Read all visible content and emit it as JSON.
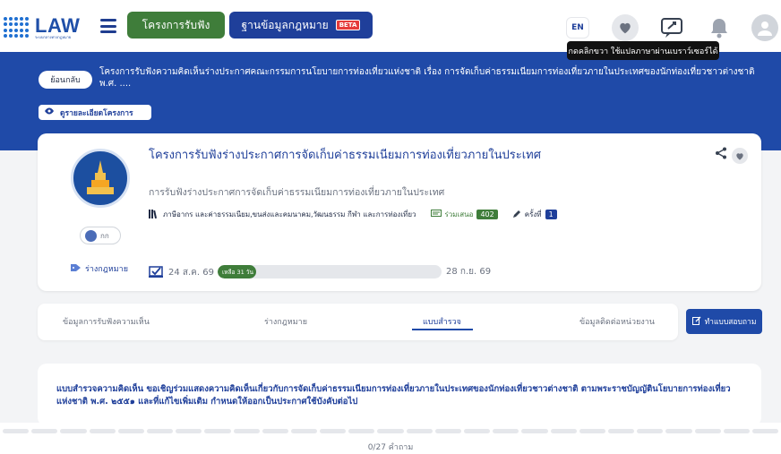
{
  "header": {
    "logo_word": "LAW",
    "logo_sub": "ระบบกลางทางกฎหมาย",
    "projects_label": "โครงการรับฟัง",
    "lawdb_label": "ฐานข้อมูลกฎหมาย",
    "beta_label": "BETA",
    "lang_label": "EN",
    "tooltip": "กดคลิกขวา ใช้แปลภาษาผ่านเบราว์เซอร์ได้"
  },
  "banner": {
    "back_label": "ย้อนกลับ",
    "title": "โครงการรับฟังความคิดเห็นร่างประกาศคณะกรรมการนโยบายการท่องเที่ยวแห่งชาติ เรื่อง การจัดเก็บค่าธรรมเนียมการท่องเที่ยวภายในประเทศของนักท่องเที่ยวชาวต่างชาติ พ.ศ. ....",
    "detail_label": "ดูรายละเอียดโครงการ"
  },
  "project": {
    "title": "โครงการรับฟังร่างประกาศการจัดเก็บค่าธรรมเนียมการท่องเที่ยวภายในประเทศ",
    "description": "การรับฟังร่างประกาศการจัดเก็บค่าธรรมเนียมการท่องเที่ยวภายในประเทศ",
    "categories": "ภาษีอากร และค่าธรรมเนียม,ขนส่งและคมนาคม,วัฒนธรรม กีฬา และการท่องเที่ยว",
    "participants_label": "ร่วมเสนอ",
    "participants_count": "402",
    "round_label": "ครั้งที่",
    "round_value": "1",
    "user_label": "กก",
    "law_tag": "ร่างกฎหมาย",
    "start_date": "24 ส.ค. 69",
    "end_date": "28 ก.ย. 69",
    "remaining_label": "เหลือ 31 วัน",
    "progress_fraction": 0.17
  },
  "tabs": [
    {
      "label": "ข้อมูลการรับฟังความเห็น",
      "active": false
    },
    {
      "label": "ร่างกฎหมาย",
      "active": false
    },
    {
      "label": "แบบสำรวจ",
      "active": true
    },
    {
      "label": "ข้อมูลติดต่อหน่วยงาน",
      "active": false
    }
  ],
  "survey_button_label": "ทำแบบสอบถาม",
  "survey": {
    "intro": "แบบสำรวจความคิดเห็น ขอเชิญร่วมแสดงความคิดเห็นเกี่ยวกับการจัดเก็บค่าธรรมเนียมการท่องเที่ยวภายในประเทศของนักท่องเที่ยวชาวต่างชาติ ตามพระราชบัญญัตินโยบายการท่องเที่ยวแห่งชาติ พ.ศ. ๒๕๕๑ และที่แก้ไขเพิ่มเติม กำหนดให้ออกเป็นประกาศใช้บังคับต่อไป"
  },
  "question_counter": "0/27 คำถาม",
  "colors": {
    "brand_blue": "#1f4aa8",
    "brand_green": "#3f7d3a",
    "beta_red": "#e53b3b"
  },
  "icons": [
    "logo-dots-icon",
    "hamburger-icon",
    "heart-icon",
    "translate-icon",
    "bell-icon",
    "user-icon",
    "eye-icon",
    "share-icon",
    "books-icon",
    "comment-icon",
    "pencil-icon",
    "tag-icon",
    "calendar-check-icon",
    "edit-icon"
  ]
}
